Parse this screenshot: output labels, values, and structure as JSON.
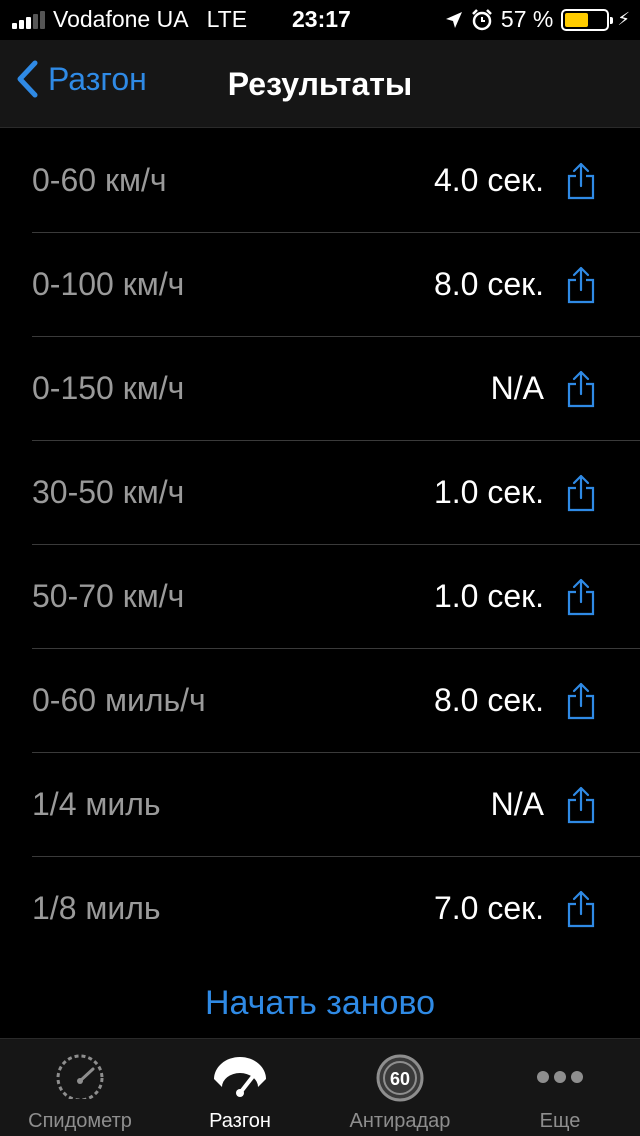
{
  "status_bar": {
    "carrier": "Vodafone UA",
    "network": "LTE",
    "time": "23:17",
    "battery_percent": "57 %",
    "battery_level": 0.57,
    "battery_color": "#ffcc00"
  },
  "nav": {
    "back_label": "Разгон",
    "title": "Результаты"
  },
  "results": [
    {
      "label": "0-60 км/ч",
      "value": "4.0 сек."
    },
    {
      "label": "0-100 км/ч",
      "value": "8.0 сек."
    },
    {
      "label": "0-150 км/ч",
      "value": "N/A"
    },
    {
      "label": "30-50 км/ч",
      "value": "1.0 сек."
    },
    {
      "label": "50-70 км/ч",
      "value": "1.0 сек."
    },
    {
      "label": "0-60 миль/ч",
      "value": "8.0 сек."
    },
    {
      "label": "1/4 миль",
      "value": "N/A"
    },
    {
      "label": "1/8 миль",
      "value": "7.0 сек."
    }
  ],
  "restart_label": "Начать заново",
  "tabs": [
    {
      "label": "Спидометр",
      "icon": "speedometer-icon",
      "active": false
    },
    {
      "label": "Разгон",
      "icon": "acceleration-icon",
      "active": true
    },
    {
      "label": "Антирадар",
      "icon": "speed-limit-60-icon",
      "icon_text": "60",
      "active": false
    },
    {
      "label": "Еще",
      "icon": "more-dots-icon",
      "active": false
    }
  ],
  "colors": {
    "accent": "#2f8ae5",
    "background": "#000000",
    "bar_background": "#161616"
  }
}
